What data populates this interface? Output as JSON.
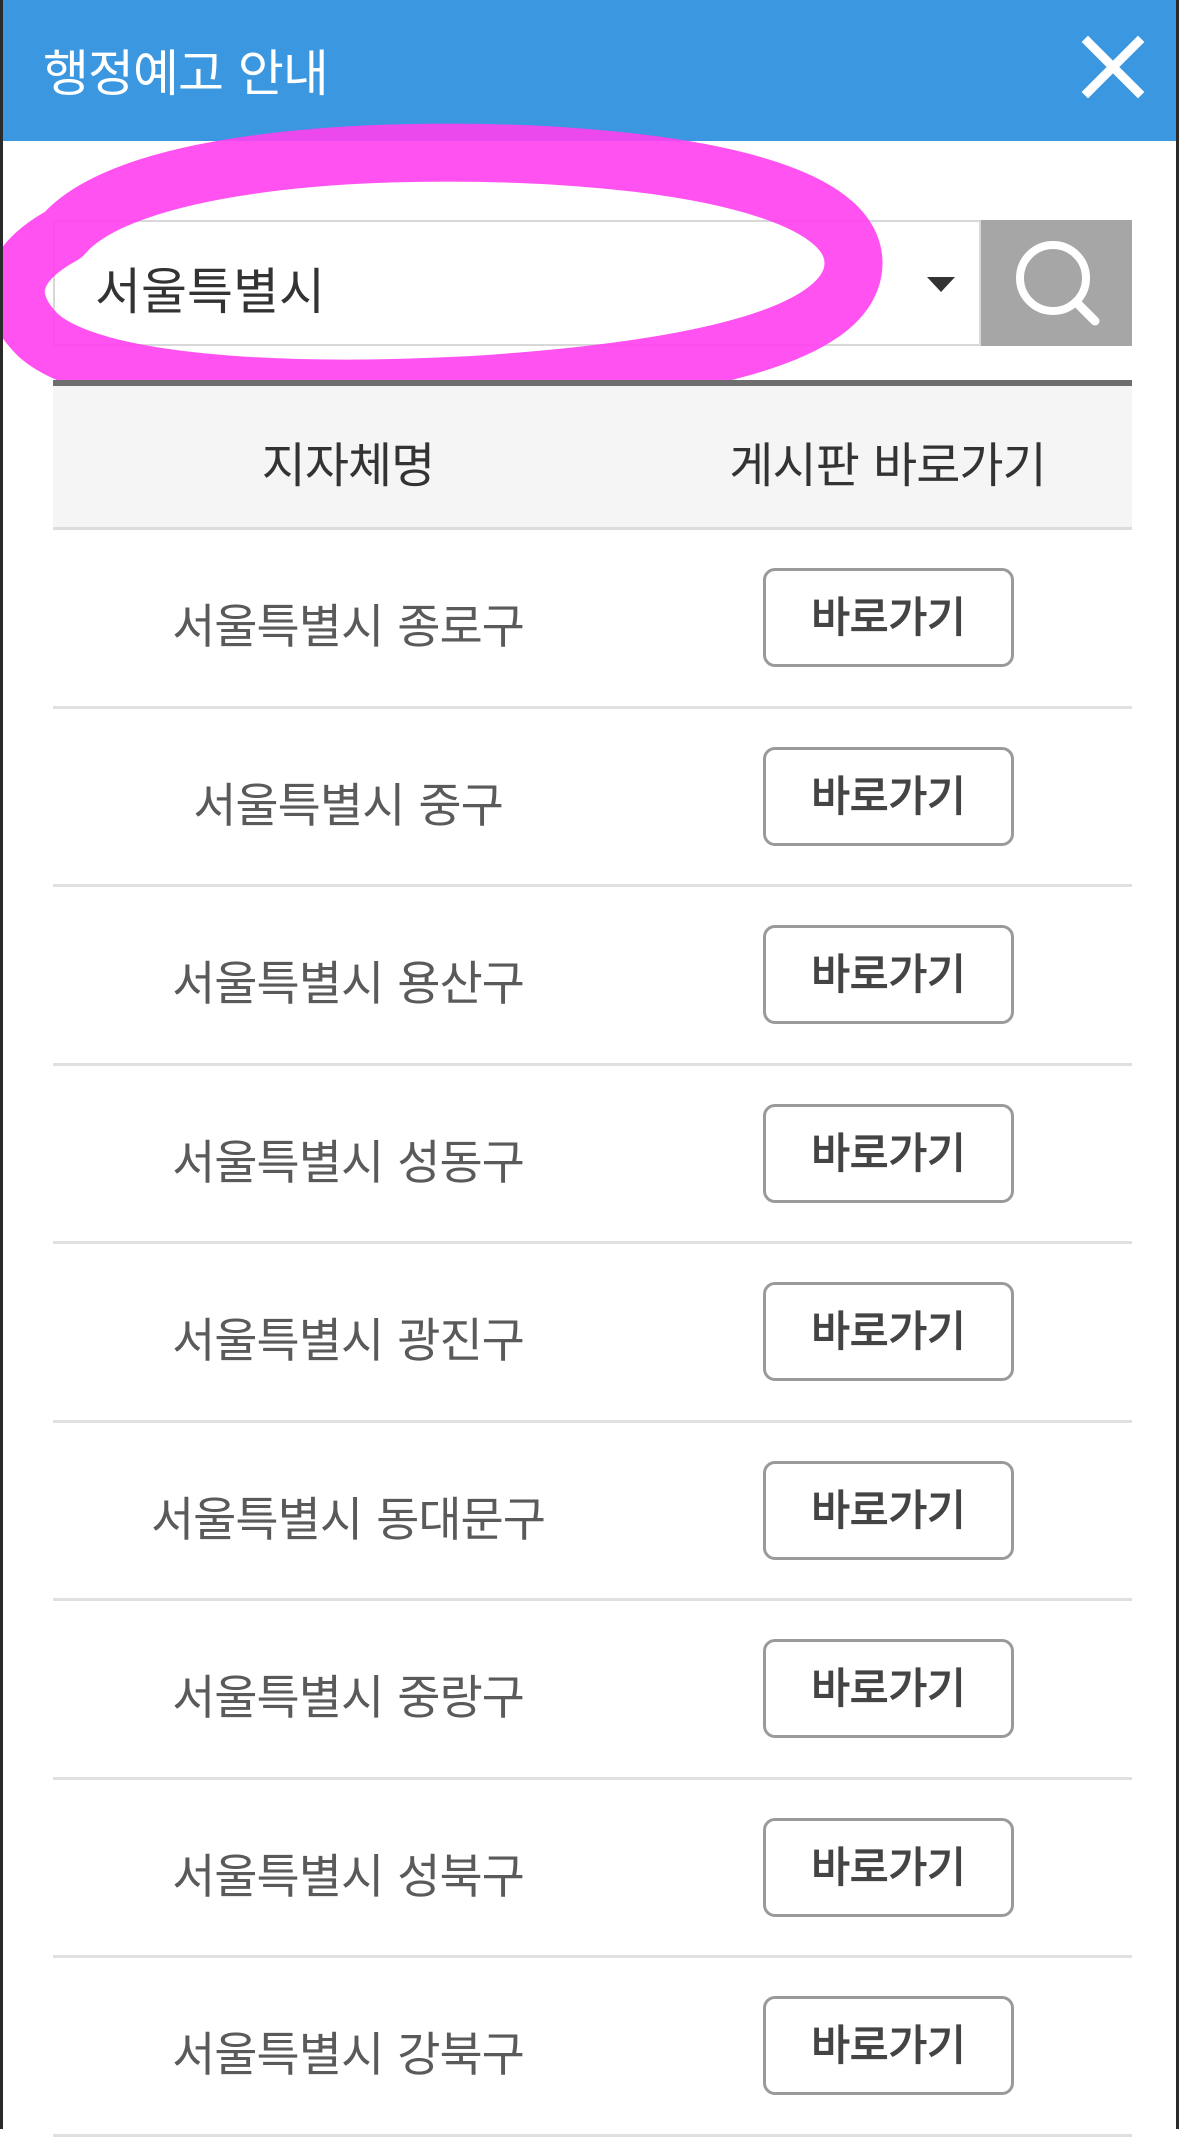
{
  "header": {
    "title": "행정예고 안내",
    "close_icon": "close-icon",
    "color": "#3a97e0"
  },
  "search": {
    "selected_value": "서울특별시",
    "search_icon": "search-icon",
    "button_color": "#a6a6a6",
    "annotation_color": "#ff3ff0"
  },
  "table": {
    "columns": [
      "지자체명",
      "게시판 바로가기"
    ],
    "rows": [
      {
        "name": "서울특별시 종로구",
        "action": "바로가기"
      },
      {
        "name": "서울특별시 중구",
        "action": "바로가기"
      },
      {
        "name": "서울특별시 용산구",
        "action": "바로가기"
      },
      {
        "name": "서울특별시 성동구",
        "action": "바로가기"
      },
      {
        "name": "서울특별시 광진구",
        "action": "바로가기"
      },
      {
        "name": "서울특별시 동대문구",
        "action": "바로가기"
      },
      {
        "name": "서울특별시 중랑구",
        "action": "바로가기"
      },
      {
        "name": "서울특별시 성북구",
        "action": "바로가기"
      },
      {
        "name": "서울특별시 강북구",
        "action": "바로가기"
      }
    ]
  }
}
